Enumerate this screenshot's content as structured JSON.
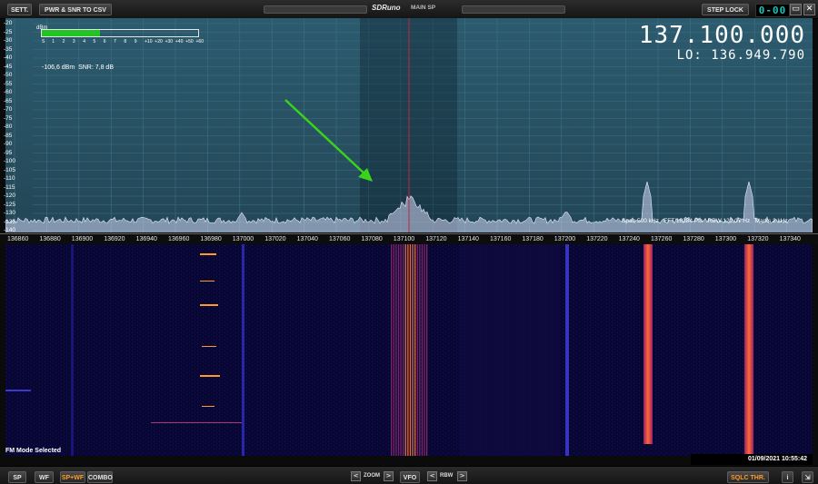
{
  "top": {
    "settings_label": "SETT.",
    "export_label": "PWR & SNR TO CSV",
    "app_title": "SDRuno",
    "panel_name": "MAIN SP",
    "step_lock_label": "STEP LOCK",
    "lcd_value": "0-00",
    "restore_glyph": "▭",
    "close_glyph": "✕"
  },
  "meter": {
    "unit": "dBm",
    "fill_fraction": 0.37,
    "scale": [
      "S",
      "1",
      "2",
      "3",
      "4",
      "5",
      "6",
      "7",
      "8",
      "9",
      "+10",
      "+20",
      "+30",
      "+40",
      "+50",
      "+60"
    ],
    "level_text": "-106,6 dBm",
    "snr_text": "SNR: 7,8 dB"
  },
  "frequency": {
    "main": "137.100.000",
    "lo": "LO: 136.949.790"
  },
  "yaxis": [
    "-20",
    "-25",
    "-30",
    "-35",
    "-40",
    "-45",
    "-50",
    "-55",
    "-60",
    "-65",
    "-70",
    "-75",
    "-80",
    "-85",
    "-90",
    "-95",
    "-100",
    "-105",
    "-110",
    "-115",
    "-120",
    "-125",
    "-130",
    "-135",
    "-140"
  ],
  "xaxis": [
    "136860",
    "136880",
    "136900",
    "136920",
    "136940",
    "136960",
    "136980",
    "137000",
    "137020",
    "137040",
    "137060",
    "137080",
    "137100",
    "137120",
    "137140",
    "137160",
    "137180",
    "137200",
    "137220",
    "137240",
    "137260",
    "137280",
    "137300",
    "137320",
    "137340"
  ],
  "info": {
    "span": "Span 500 kHz",
    "fft": "FFT 16384 Pts",
    "rbw": "RBW 122,07 Hz",
    "marks": "Marks 2 kHz"
  },
  "status": {
    "mode": "FM Mode Selected",
    "datetime": "01/09/2021 10:55:42"
  },
  "bottom": {
    "sp": "SP",
    "wf": "WF",
    "sp_wf": "SP+WF",
    "combo": "COMBO",
    "zoom": "ZOOM",
    "vfo": "VFO",
    "rbw": "RBW",
    "sqlc": "SQLC THR.",
    "info_btn": "i",
    "resize_glyph": "⇲",
    "left_glyph": "<",
    "right_glyph": ">"
  },
  "colors": {
    "accent_orange": "#ff9a2a",
    "lcd_cyan": "#16c4b9",
    "spectrum_bg": "#2a566a",
    "waterfall_bg": "#07062e",
    "marker_red": "#c0283a",
    "annotation_arrow": "#39d31b"
  }
}
